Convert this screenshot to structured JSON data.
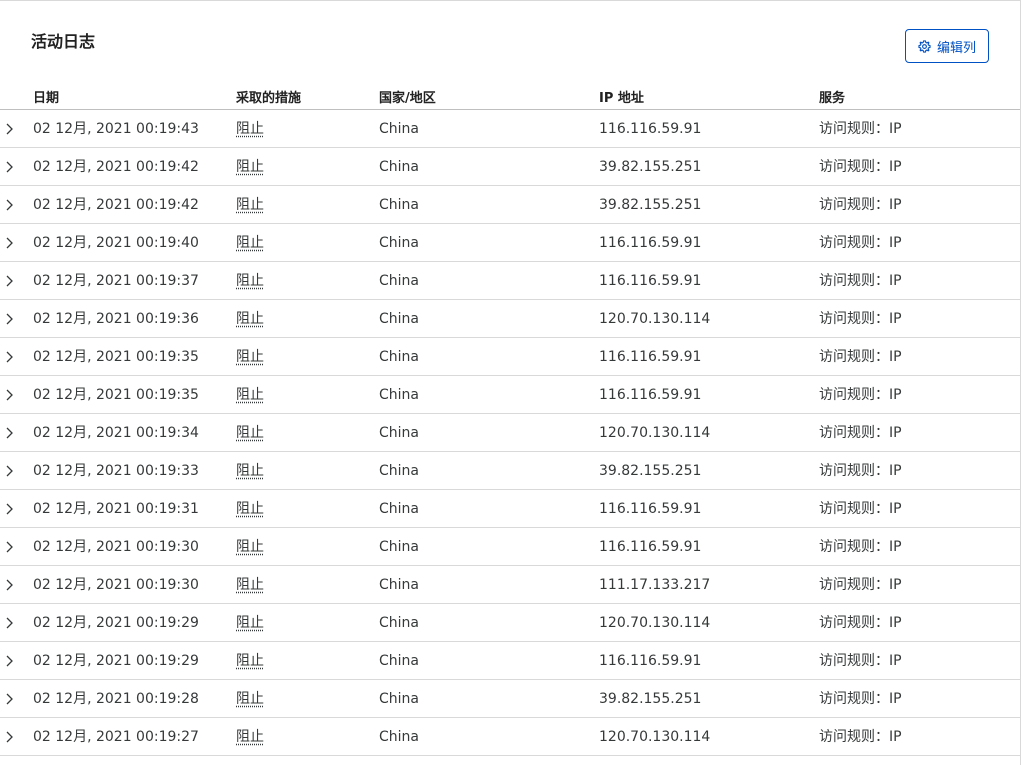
{
  "header": {
    "title": "活动日志",
    "edit_columns_label": "编辑列"
  },
  "columns": {
    "date": "日期",
    "action": "采取的措施",
    "country": "国家/地区",
    "ip": "IP 地址",
    "service": "服务"
  },
  "rows": [
    {
      "date": "02 12月, 2021 00:19:43",
      "action": "阻止",
      "country": "China",
      "ip": "116.116.59.91",
      "service": "访问规则：IP"
    },
    {
      "date": "02 12月, 2021 00:19:42",
      "action": "阻止",
      "country": "China",
      "ip": "39.82.155.251",
      "service": "访问规则：IP"
    },
    {
      "date": "02 12月, 2021 00:19:42",
      "action": "阻止",
      "country": "China",
      "ip": "39.82.155.251",
      "service": "访问规则：IP"
    },
    {
      "date": "02 12月, 2021 00:19:40",
      "action": "阻止",
      "country": "China",
      "ip": "116.116.59.91",
      "service": "访问规则：IP"
    },
    {
      "date": "02 12月, 2021 00:19:37",
      "action": "阻止",
      "country": "China",
      "ip": "116.116.59.91",
      "service": "访问规则：IP"
    },
    {
      "date": "02 12月, 2021 00:19:36",
      "action": "阻止",
      "country": "China",
      "ip": "120.70.130.114",
      "service": "访问规则：IP"
    },
    {
      "date": "02 12月, 2021 00:19:35",
      "action": "阻止",
      "country": "China",
      "ip": "116.116.59.91",
      "service": "访问规则：IP"
    },
    {
      "date": "02 12月, 2021 00:19:35",
      "action": "阻止",
      "country": "China",
      "ip": "116.116.59.91",
      "service": "访问规则：IP"
    },
    {
      "date": "02 12月, 2021 00:19:34",
      "action": "阻止",
      "country": "China",
      "ip": "120.70.130.114",
      "service": "访问规则：IP"
    },
    {
      "date": "02 12月, 2021 00:19:33",
      "action": "阻止",
      "country": "China",
      "ip": "39.82.155.251",
      "service": "访问规则：IP"
    },
    {
      "date": "02 12月, 2021 00:19:31",
      "action": "阻止",
      "country": "China",
      "ip": "116.116.59.91",
      "service": "访问规则：IP"
    },
    {
      "date": "02 12月, 2021 00:19:30",
      "action": "阻止",
      "country": "China",
      "ip": "116.116.59.91",
      "service": "访问规则：IP"
    },
    {
      "date": "02 12月, 2021 00:19:30",
      "action": "阻止",
      "country": "China",
      "ip": "111.17.133.217",
      "service": "访问规则：IP"
    },
    {
      "date": "02 12月, 2021 00:19:29",
      "action": "阻止",
      "country": "China",
      "ip": "120.70.130.114",
      "service": "访问规则：IP"
    },
    {
      "date": "02 12月, 2021 00:19:29",
      "action": "阻止",
      "country": "China",
      "ip": "116.116.59.91",
      "service": "访问规则：IP"
    },
    {
      "date": "02 12月, 2021 00:19:28",
      "action": "阻止",
      "country": "China",
      "ip": "39.82.155.251",
      "service": "访问规则：IP"
    },
    {
      "date": "02 12月, 2021 00:19:27",
      "action": "阻止",
      "country": "China",
      "ip": "120.70.130.114",
      "service": "访问规则：IP"
    }
  ],
  "icons": {
    "edit_columns": "gear-icon",
    "row_expand": "chevron-right-icon"
  },
  "colors": {
    "accent": "#0051c3",
    "border": "#d9d9d9",
    "text": "#36393a"
  }
}
